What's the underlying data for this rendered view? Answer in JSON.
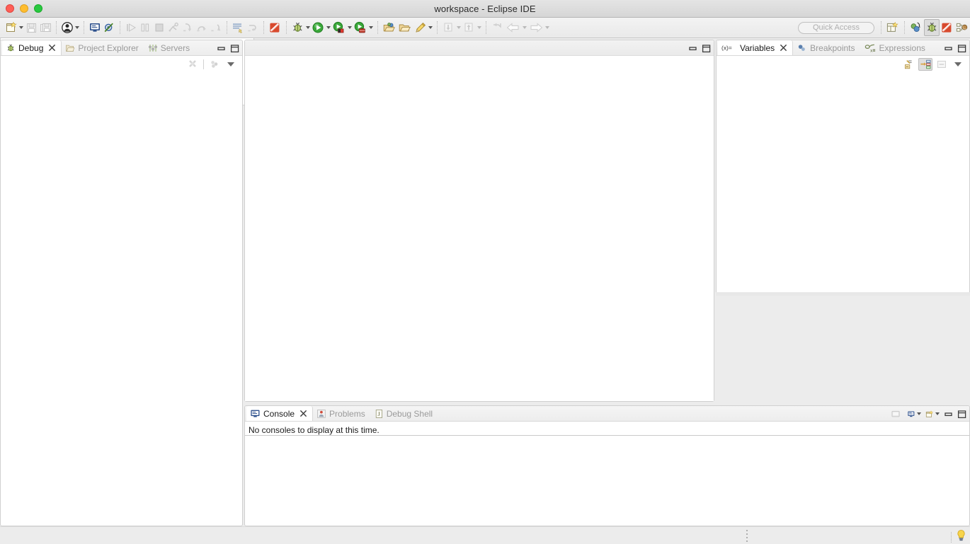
{
  "window": {
    "title": "workspace - Eclipse IDE",
    "controls": {
      "close": "close",
      "minimize": "minimize",
      "maximize": "maximize"
    }
  },
  "toolbar": {
    "quick_access_placeholder": "Quick Access",
    "items": [
      {
        "name": "new-wizard",
        "label": "New",
        "icon": "new-file-icon",
        "enabled": true,
        "dropdown": true
      },
      {
        "name": "save",
        "label": "Save",
        "icon": "save-icon",
        "enabled": false,
        "dropdown": false
      },
      {
        "name": "save-all",
        "label": "Save All",
        "icon": "save-all-icon",
        "enabled": false,
        "dropdown": false
      },
      {
        "name": "user",
        "label": "User",
        "icon": "person-icon",
        "enabled": true,
        "dropdown": true
      },
      {
        "name": "open-console",
        "label": "Open Console",
        "icon": "console-icon",
        "enabled": true,
        "dropdown": false
      },
      {
        "name": "skip-breakpoints",
        "label": "Skip All Breakpoints",
        "icon": "skip-breakpoints-icon",
        "enabled": true,
        "dropdown": false
      },
      {
        "name": "resume",
        "label": "Resume",
        "icon": "resume-icon",
        "enabled": false,
        "dropdown": false
      },
      {
        "name": "suspend",
        "label": "Suspend",
        "icon": "suspend-icon",
        "enabled": false,
        "dropdown": false
      },
      {
        "name": "terminate",
        "label": "Terminate",
        "icon": "terminate-icon",
        "enabled": false,
        "dropdown": false
      },
      {
        "name": "disconnect",
        "label": "Disconnect",
        "icon": "disconnect-icon",
        "enabled": false,
        "dropdown": false
      },
      {
        "name": "step-into",
        "label": "Step Into",
        "icon": "step-into-icon",
        "enabled": false,
        "dropdown": false
      },
      {
        "name": "step-over",
        "label": "Step Over",
        "icon": "step-over-icon",
        "enabled": false,
        "dropdown": false
      },
      {
        "name": "step-return",
        "label": "Step Return",
        "icon": "step-return-icon",
        "enabled": false,
        "dropdown": false
      },
      {
        "name": "instruction-stepping",
        "label": "Instruction Stepping Mode",
        "icon": "instruction-step-icon",
        "enabled": true,
        "dropdown": false
      },
      {
        "name": "drop-to-frame",
        "label": "Drop to Frame",
        "icon": "drop-to-frame-icon",
        "enabled": false,
        "dropdown": false
      },
      {
        "name": "new-java-project",
        "label": "New Java Project",
        "icon": "java-project-icon",
        "enabled": true,
        "dropdown": false
      },
      {
        "name": "debug",
        "label": "Debug",
        "icon": "debug-bug-icon",
        "enabled": true,
        "dropdown": true
      },
      {
        "name": "run",
        "label": "Run",
        "icon": "run-play-icon",
        "enabled": true,
        "dropdown": true
      },
      {
        "name": "run-server",
        "label": "Run on Server",
        "icon": "run-server-icon",
        "enabled": true,
        "dropdown": true
      },
      {
        "name": "profile",
        "label": "Profile",
        "icon": "profile-icon",
        "enabled": true,
        "dropdown": true
      },
      {
        "name": "open-type",
        "label": "Open Type",
        "icon": "open-type-icon",
        "enabled": true,
        "dropdown": false
      },
      {
        "name": "open-task",
        "label": "Open Task",
        "icon": "open-task-icon",
        "enabled": true,
        "dropdown": false
      },
      {
        "name": "toggle-mark",
        "label": "Toggle Mark Occurrences",
        "icon": "pencil-icon",
        "enabled": true,
        "dropdown": true
      },
      {
        "name": "previous-annotation",
        "label": "Previous Annotation",
        "icon": "prev-annotation-icon",
        "enabled": false,
        "dropdown": true
      },
      {
        "name": "next-annotation",
        "label": "Next Annotation",
        "icon": "next-annotation-icon",
        "enabled": false,
        "dropdown": true
      },
      {
        "name": "last-edit-location",
        "label": "Last Edit Location",
        "icon": "last-edit-icon",
        "enabled": false,
        "dropdown": false
      },
      {
        "name": "back",
        "label": "Back",
        "icon": "back-arrow-icon",
        "enabled": false,
        "dropdown": true
      },
      {
        "name": "forward",
        "label": "Forward",
        "icon": "forward-arrow-icon",
        "enabled": false,
        "dropdown": true
      }
    ],
    "perspectives": [
      {
        "name": "open-perspective",
        "label": "Open Perspective",
        "icon": "open-perspective-icon",
        "active": false
      },
      {
        "name": "perspective-java-ee",
        "label": "Java EE",
        "icon": "java-ee-perspective-icon",
        "active": false
      },
      {
        "name": "perspective-debug",
        "label": "Debug",
        "icon": "debug-perspective-icon",
        "active": true
      },
      {
        "name": "perspective-java",
        "label": "Java",
        "icon": "java-perspective-icon",
        "active": false
      },
      {
        "name": "perspective-team-sync",
        "label": "Team Synchronizing",
        "icon": "team-sync-perspective-icon",
        "active": false
      }
    ]
  },
  "left_panel": {
    "tabs": [
      {
        "label": "Debug",
        "icon": "debug-bug-icon",
        "active": true,
        "closable": true
      },
      {
        "label": "Project Explorer",
        "icon": "project-explorer-icon",
        "active": false,
        "closable": false
      },
      {
        "label": "Servers",
        "icon": "servers-icon",
        "active": false,
        "closable": false
      }
    ],
    "tools": [
      {
        "name": "remove-all-terminated",
        "label": "Remove All Terminated",
        "icon": "remove-terminated-icon",
        "enabled": false
      },
      {
        "name": "debug-view-menu-group",
        "label": "Group By",
        "icon": "group-by-icon",
        "enabled": false
      }
    ],
    "view_menu_label": "View Menu",
    "minimize_label": "Minimize",
    "maximize_label": "Maximize",
    "content": ""
  },
  "editor_area": {
    "minimize_label": "Minimize",
    "restore_label": "Restore",
    "content": ""
  },
  "right_panel": {
    "tabs": [
      {
        "label": "Variables",
        "icon": "variables-icon",
        "active": true,
        "closable": true
      },
      {
        "label": "Breakpoints",
        "icon": "breakpoints-icon",
        "active": false,
        "closable": false
      },
      {
        "label": "Expressions",
        "icon": "expressions-icon",
        "active": false,
        "closable": false
      }
    ],
    "tools": [
      {
        "name": "collapse-all",
        "label": "Collapse All",
        "icon": "collapse-all-icon",
        "enabled": true,
        "pressed": false
      },
      {
        "name": "show-logical-structure",
        "label": "Show Logical Structure",
        "icon": "logical-structure-icon",
        "enabled": true,
        "pressed": true
      },
      {
        "name": "toggle-detail-pane",
        "label": "Toggle Detail Pane",
        "icon": "detail-pane-icon",
        "enabled": false,
        "pressed": false
      }
    ],
    "view_menu_label": "View Menu",
    "minimize_label": "Minimize",
    "maximize_label": "Maximize",
    "content": ""
  },
  "right_lower": {
    "content": ""
  },
  "console_panel": {
    "tabs": [
      {
        "label": "Console",
        "icon": "console-icon",
        "active": true,
        "closable": true
      },
      {
        "label": "Problems",
        "icon": "problems-icon",
        "active": false,
        "closable": false
      },
      {
        "label": "Debug Shell",
        "icon": "debug-shell-icon",
        "active": false,
        "closable": false
      }
    ],
    "message": "No consoles to display at this time.",
    "tools": [
      {
        "name": "open-console-view",
        "label": "Open Console",
        "icon": "open-console-small-icon",
        "enabled": false,
        "dropdown": false
      },
      {
        "name": "display-selected-console",
        "label": "Display Selected Console",
        "icon": "display-console-icon",
        "enabled": true,
        "dropdown": true
      },
      {
        "name": "new-console-view",
        "label": "New Console View",
        "icon": "new-console-icon",
        "enabled": true,
        "dropdown": true
      }
    ],
    "minimize_label": "Minimize",
    "maximize_label": "Maximize"
  },
  "statusbar": {
    "message": "",
    "tip_icon": "lightbulb-tip-icon",
    "tip_label": "Tip"
  },
  "colors": {
    "window_chrome": "#ececec",
    "panel_bg": "#ffffff",
    "tab_active_text": "#1a1a1a",
    "tab_inactive_text": "#9a9a9a",
    "accent_blue": "#2c4f8c",
    "traffic_close": "#ff5f57",
    "traffic_min": "#ffbd2e",
    "traffic_max": "#28c840"
  }
}
